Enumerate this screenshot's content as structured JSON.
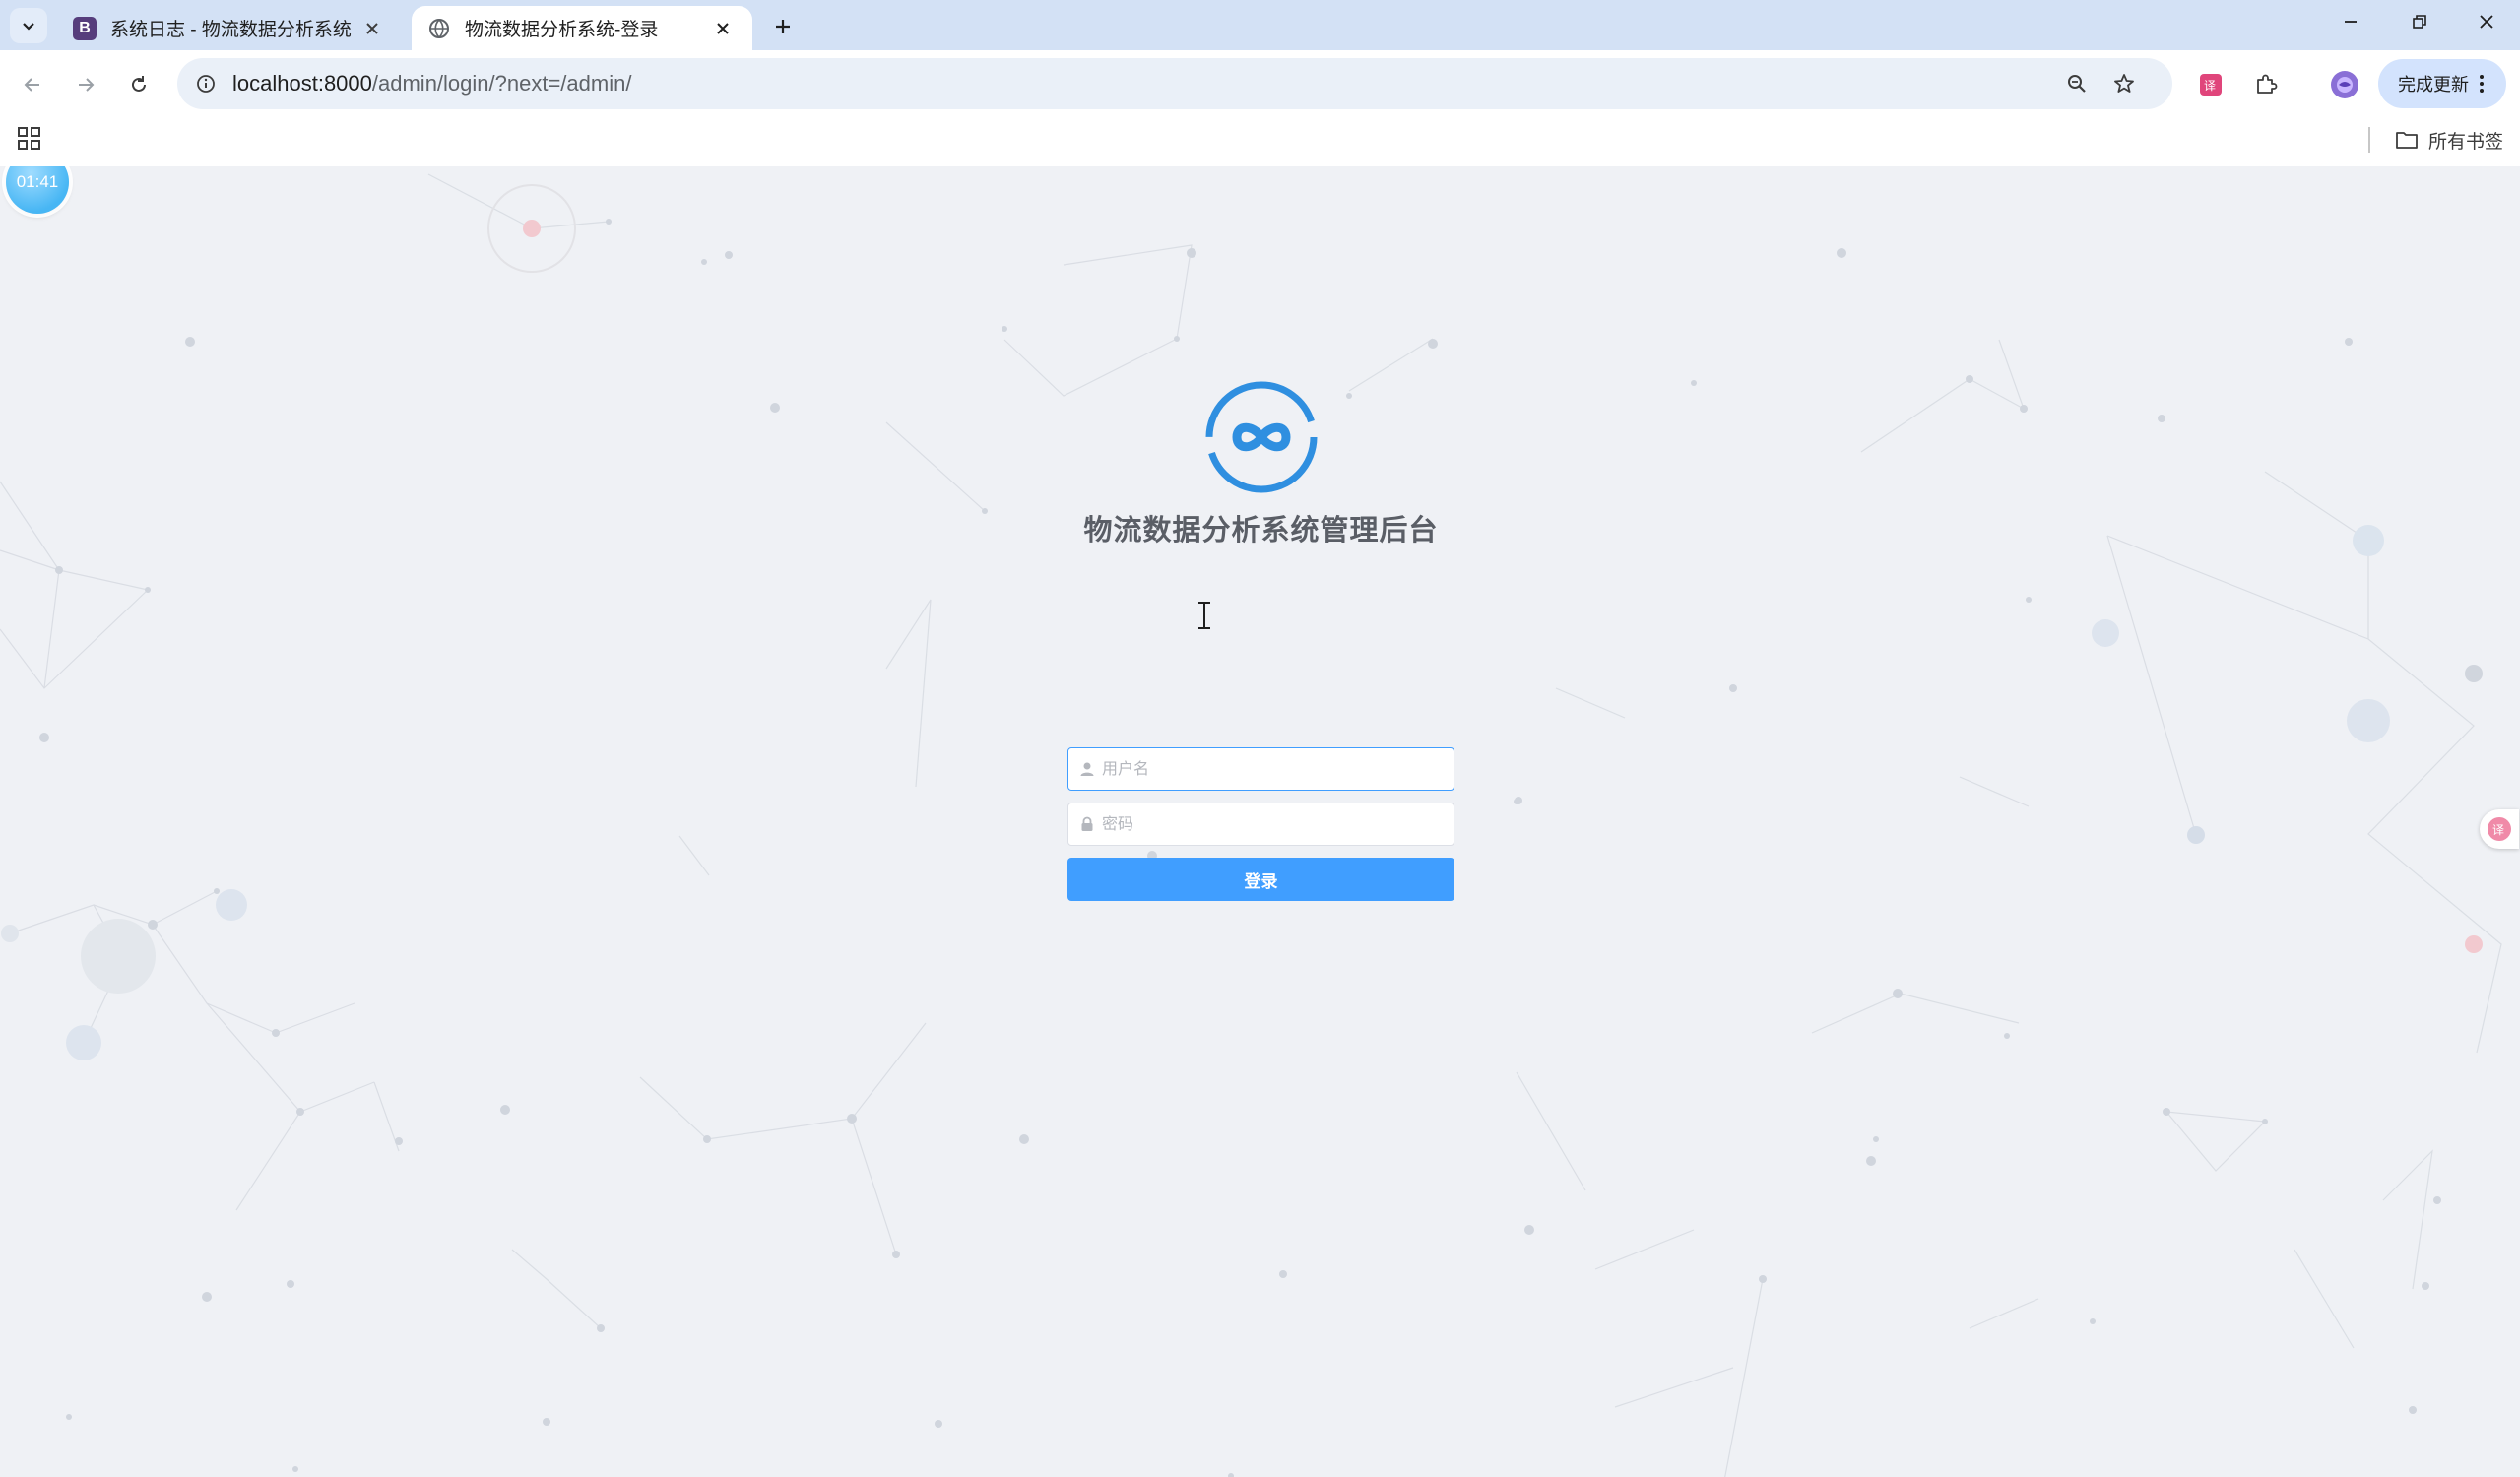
{
  "browser": {
    "tabs": [
      {
        "favicon": "B",
        "title": "系统日志 - 物流数据分析系统",
        "active": false
      },
      {
        "favicon": "globe",
        "title": "物流数据分析系统-登录",
        "active": true
      }
    ],
    "url": {
      "host": "localhost:8000",
      "path": "/admin/login/?next=/admin/"
    },
    "update_button": "完成更新",
    "bookmarks_all": "所有书签",
    "icons": {
      "tab_search": "chevron-down-icon",
      "new_tab": "plus-icon",
      "back": "arrow-left-icon",
      "forward": "arrow-right-icon",
      "reload": "reload-icon",
      "site_info": "info-icon",
      "zoom": "zoom-icon",
      "bookmark": "star-icon",
      "translate_ext": "translate-icon",
      "extensions": "puzzle-icon",
      "profile": "avatar"
    }
  },
  "overlay": {
    "timer": "01:41"
  },
  "login": {
    "title": "物流数据分析系统管理后台",
    "username_placeholder": "用户名",
    "password_placeholder": "密码",
    "submit_label": "登录"
  },
  "colors": {
    "accent": "#409eff",
    "logo": "#2f8fe0",
    "page_bg": "#eff1f5",
    "tab_strip": "#d3e1f5"
  }
}
